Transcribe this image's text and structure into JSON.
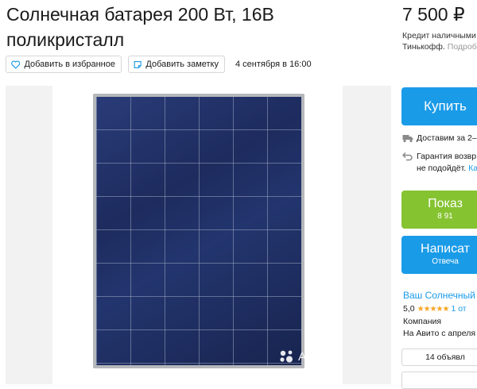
{
  "listing": {
    "title": "Солнечная батарея 200 Вт, 16В поликристалл",
    "price": "7 500 ₽",
    "credit_line1": "Кредит наличными",
    "credit_line2_bank": "Тинькофф.",
    "credit_line2_link": "Подроб",
    "favorite_label": "Добавить в избранное",
    "note_label": "Добавить заметку",
    "date": "4 сентября в 16:00"
  },
  "gallery": {
    "watermark": "Avito"
  },
  "actions": {
    "buy_label": "Купить",
    "show_phone_label": "Показ",
    "phone_partial": "8 91",
    "write_label": "Написат",
    "write_sub": "Отвеча"
  },
  "delivery": {
    "shipping": "Доставим за 2–",
    "guarantee_line1": "Гарантия возвр",
    "guarantee_line2": "не подойдёт.",
    "guarantee_link": "Ка"
  },
  "seller": {
    "name": "Ваш Солнечный",
    "rating": "5,0",
    "stars": "★★★★★",
    "reviews": "1 от",
    "type": "Компания",
    "since": "На Авито с апреля",
    "ads_count_label": "14 объявл"
  },
  "colors": {
    "accent_blue": "#1a9be8",
    "green": "#85c330",
    "star": "#f5a623"
  }
}
